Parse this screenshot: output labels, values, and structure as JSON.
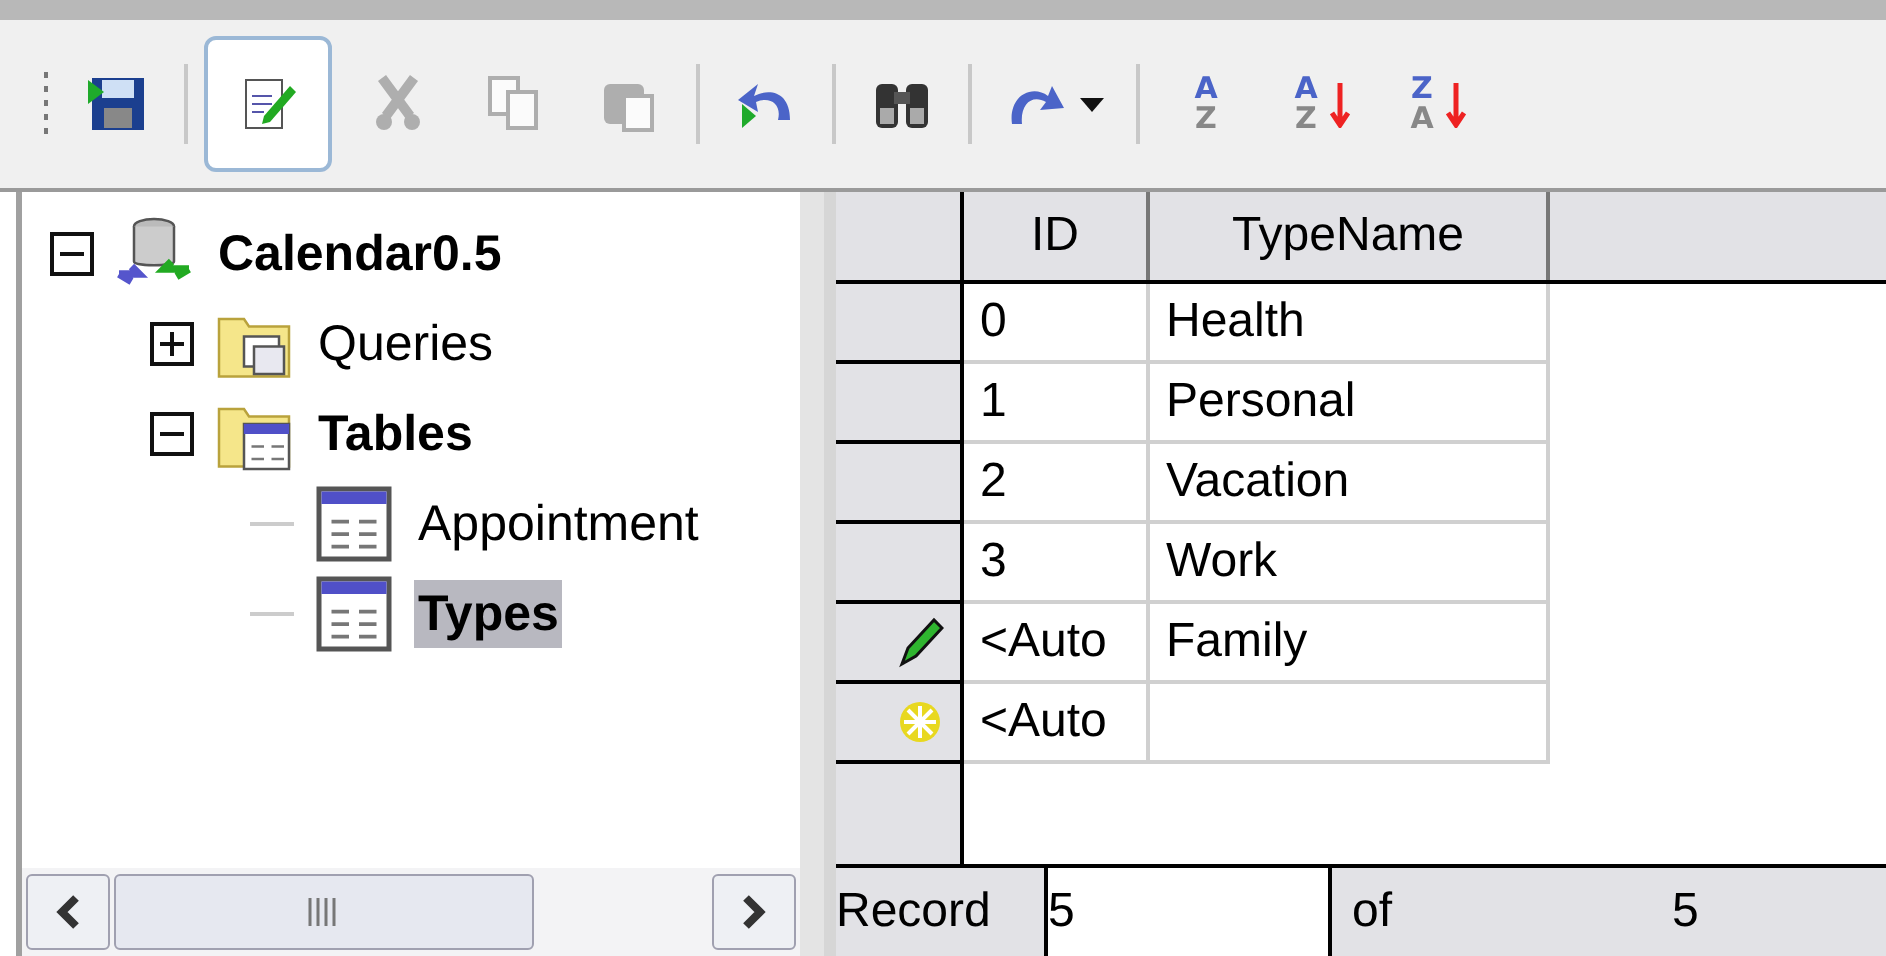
{
  "toolbar": [
    {
      "kind": "save",
      "selected": false,
      "disabled": false
    },
    {
      "kind": "edit",
      "selected": true,
      "disabled": false
    },
    {
      "kind": "cut",
      "selected": false,
      "disabled": true
    },
    {
      "kind": "copy",
      "selected": false,
      "disabled": true
    },
    {
      "kind": "paste",
      "selected": false,
      "disabled": true
    },
    {
      "kind": "undo",
      "selected": false,
      "disabled": false
    },
    {
      "kind": "find",
      "selected": false,
      "disabled": false
    },
    {
      "kind": "redo",
      "selected": false,
      "disabled": false
    },
    {
      "kind": "sort",
      "selected": false,
      "disabled": false,
      "letters": [
        "A",
        "Z"
      ]
    },
    {
      "kind": "sort_ascending",
      "selected": false,
      "disabled": false,
      "letters": [
        "A",
        "Z"
      ]
    },
    {
      "kind": "sort_descending",
      "selected": false,
      "disabled": false,
      "letters": [
        "Z",
        "A"
      ]
    }
  ],
  "tree": {
    "label": "Calendar0.5",
    "kind": "database",
    "expanded": true,
    "bold": true,
    "selected": false,
    "children": [
      {
        "label": "Queries",
        "kind": "queries",
        "expanded": false,
        "bold": false,
        "selected": false
      },
      {
        "label": "Tables",
        "kind": "tables",
        "expanded": true,
        "bold": true,
        "selected": false,
        "children": [
          {
            "label": "Appointment",
            "kind": "table",
            "bold": false,
            "selected": false
          },
          {
            "label": "Types",
            "kind": "table",
            "bold": true,
            "selected": true
          }
        ]
      }
    ]
  },
  "table": {
    "columns": [
      "ID",
      "TypeName"
    ],
    "rows": [
      {
        "kind": "normal",
        "cells": [
          "0",
          "Health"
        ]
      },
      {
        "kind": "normal",
        "cells": [
          "1",
          "Personal"
        ]
      },
      {
        "kind": "normal",
        "cells": [
          "2",
          "Vacation"
        ]
      },
      {
        "kind": "normal",
        "cells": [
          "3",
          "Work"
        ]
      },
      {
        "kind": "editing",
        "cells": [
          "<Auto",
          "Family"
        ]
      },
      {
        "kind": "new",
        "cells": [
          "<Auto"
        ]
      }
    ]
  },
  "record_bar": {
    "label": "Record",
    "value": "5",
    "of_label": "of",
    "total": "5"
  }
}
